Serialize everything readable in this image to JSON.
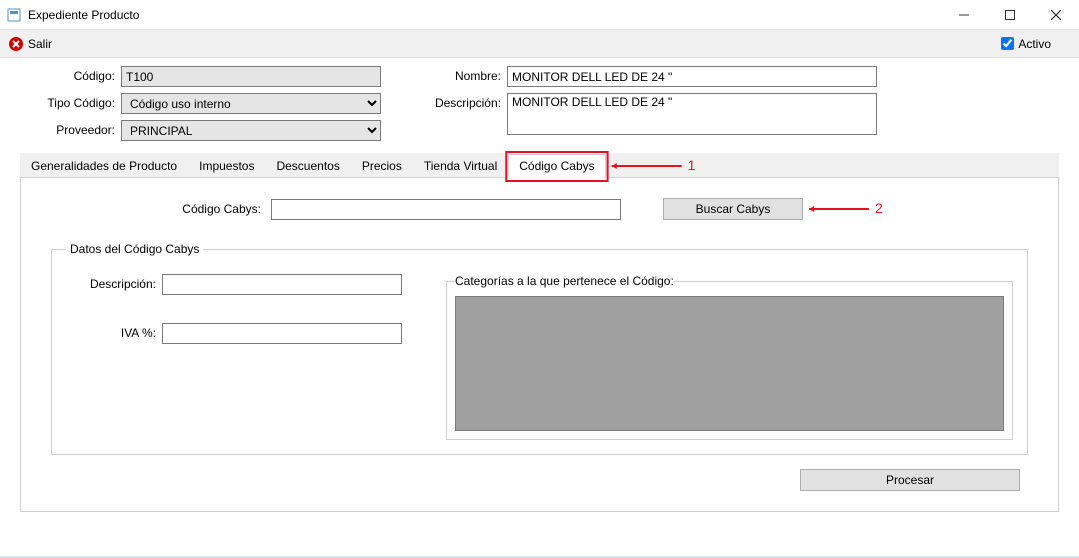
{
  "window": {
    "title": "Expediente Producto"
  },
  "toolbar": {
    "salir": "Salir",
    "activo_label": "Activo",
    "activo_checked": true
  },
  "form": {
    "codigo_label": "Código:",
    "codigo_value": "T100",
    "tipo_label": "Tipo Código:",
    "tipo_value": "Código uso interno",
    "proveedor_label": "Proveedor:",
    "proveedor_value": "PRINCIPAL",
    "nombre_label": "Nombre:",
    "nombre_value": "MONITOR DELL LED DE 24 \"",
    "desc_label": "Descripción:",
    "desc_value": "MONITOR DELL LED DE 24 \""
  },
  "tabs": [
    "Generalidades de Producto",
    "Impuestos",
    "Descuentos",
    "Precios",
    "Tienda Virtual",
    "Código Cabys"
  ],
  "active_tab_index": 5,
  "cabys": {
    "codigo_label": "Código Cabys:",
    "codigo_value": "",
    "buscar_btn": "Buscar Cabys",
    "fieldset_legend": "Datos del Código Cabys",
    "desc_label": "Descripción:",
    "desc_value": "",
    "iva_label": "IVA %:",
    "iva_value": "",
    "cats_legend": "Categorías a la que pertenece el Código:",
    "procesar_btn": "Procesar"
  },
  "annotations": {
    "one": "1",
    "two": "2"
  }
}
